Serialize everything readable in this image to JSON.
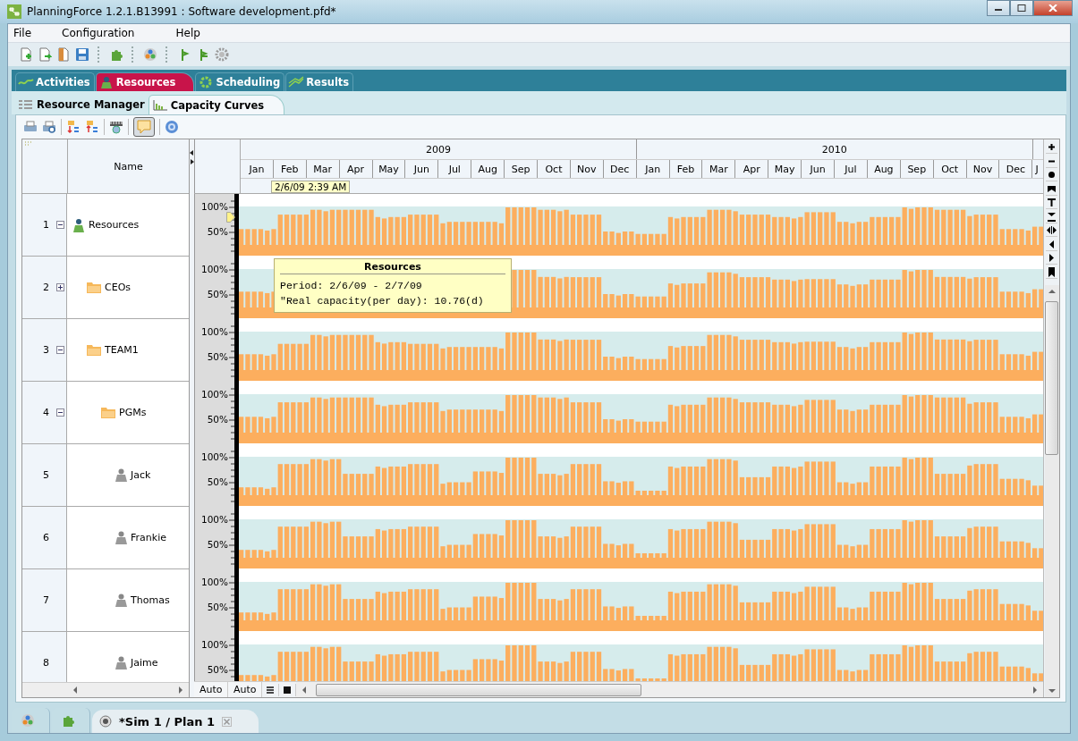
{
  "window": {
    "title": "PlanningForce 1.2.1.B13991 : Software development.pfd*"
  },
  "menu": [
    "File",
    "Configuration",
    "Help"
  ],
  "main_tabs": [
    {
      "label": "Activities",
      "selected": false
    },
    {
      "label": "Resources",
      "selected": true
    },
    {
      "label": "Scheduling",
      "selected": false
    },
    {
      "label": "Results",
      "selected": false
    }
  ],
  "sub_tabs": [
    {
      "label": "Resource Manager",
      "selected": false
    },
    {
      "label": "Capacity Curves",
      "selected": true
    }
  ],
  "panel_toolbar": {
    "tooltips_on": true
  },
  "table": {
    "name_header": "Name",
    "rows": [
      {
        "number": "1",
        "name": "Resources",
        "kind": "group",
        "expanded": true,
        "ticks": [
          "100%",
          "50%"
        ],
        "children": [
          {
            "number": "2",
            "name": "CEOs",
            "kind": "folder",
            "expanded": false,
            "ticks": [
              "100%",
              "50%"
            ]
          },
          {
            "number": "3",
            "name": "TEAM1",
            "kind": "folder",
            "expanded": true,
            "ticks": [
              "100%",
              "50%"
            ],
            "children": [
              {
                "number": "4",
                "name": "PGMs",
                "kind": "folder",
                "expanded": true,
                "ticks": [
                  "100%",
                  "50%"
                ],
                "children": [
                  {
                    "number": "5",
                    "name": "Jack",
                    "kind": "person",
                    "ticks": [
                      "100%",
                      "50%"
                    ]
                  },
                  {
                    "number": "6",
                    "name": "Frankie",
                    "kind": "person",
                    "ticks": [
                      "100%",
                      "50%"
                    ]
                  },
                  {
                    "number": "7",
                    "name": "Thomas",
                    "kind": "person",
                    "ticks": [
                      "100%",
                      "50%"
                    ]
                  },
                  {
                    "number": "8",
                    "name": "Jaime",
                    "kind": "person",
                    "ticks": [
                      "100%",
                      "50%"
                    ]
                  }
                ]
              }
            ]
          }
        ]
      }
    ]
  },
  "timeline": {
    "years": [
      {
        "label": "2009",
        "months": [
          "Jan",
          "Feb",
          "Mar",
          "Apr",
          "May",
          "Jun",
          "Jul",
          "Aug",
          "Sep",
          "Oct",
          "Nov",
          "Dec"
        ]
      },
      {
        "label": "2010",
        "months": [
          "Jan",
          "Feb",
          "Mar",
          "Apr",
          "May",
          "Jun",
          "Jul",
          "Aug",
          "Sep",
          "Oct",
          "Nov",
          "Dec"
        ]
      }
    ],
    "partial_month": "J",
    "marker": "2/6/09 2:39 AM"
  },
  "tooltip": {
    "title": "Resources",
    "lines": [
      "Period: 2/6/09 - 2/7/09",
      "\"Real capacity(per day): 10.76(d)"
    ]
  },
  "footer": {
    "buttons": [
      "Auto",
      "Auto"
    ]
  },
  "bottom_tabs": [
    {
      "label": "*Sim 1 / Plan 1",
      "selected": true
    }
  ]
}
